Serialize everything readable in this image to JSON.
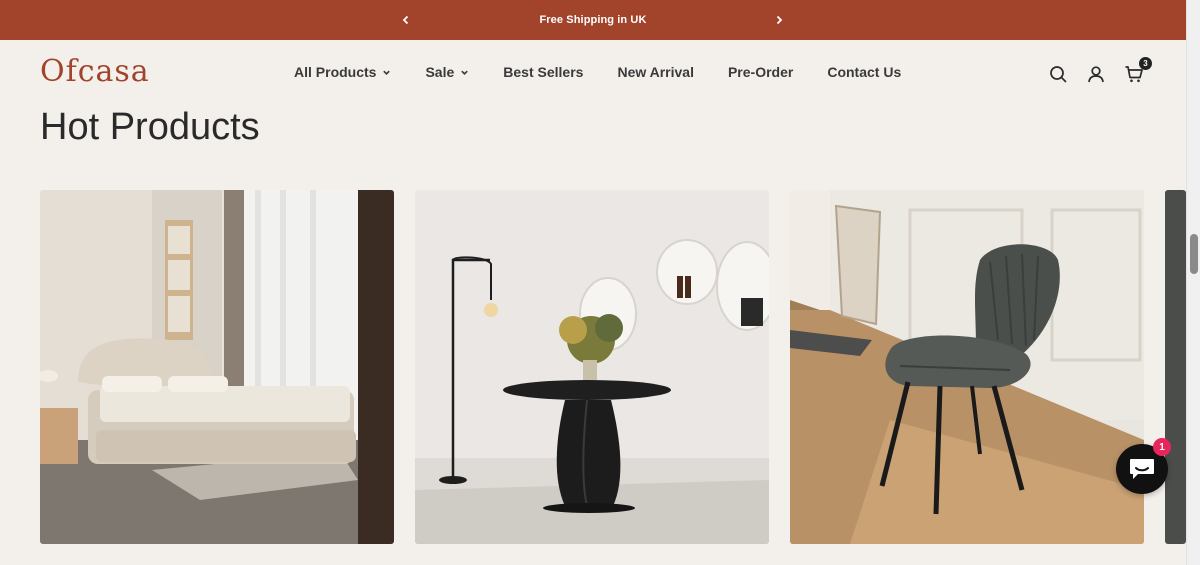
{
  "announcement": {
    "text": "Free Shipping in UK"
  },
  "header": {
    "logo": "Ofcasa",
    "nav": [
      {
        "label": "All Products",
        "has_dropdown": true
      },
      {
        "label": "Sale",
        "has_dropdown": true
      },
      {
        "label": "Best Sellers",
        "has_dropdown": false
      },
      {
        "label": "New Arrival",
        "has_dropdown": false
      },
      {
        "label": "Pre-Order",
        "has_dropdown": false
      },
      {
        "label": "Contact Us",
        "has_dropdown": false
      }
    ],
    "icons": [
      "search-icon",
      "account-icon",
      "cart-icon"
    ],
    "cart_count": "3"
  },
  "section": {
    "title": "Hot Products",
    "products": [
      {
        "image": "bedroom-bed-photo"
      },
      {
        "image": "round-dining-table-photo"
      },
      {
        "image": "grey-dining-chair-photo"
      }
    ]
  },
  "chat": {
    "badge": "1"
  },
  "colors": {
    "brand": "#a2432b",
    "background": "#f3f0ec",
    "text": "#2a2a2a"
  }
}
